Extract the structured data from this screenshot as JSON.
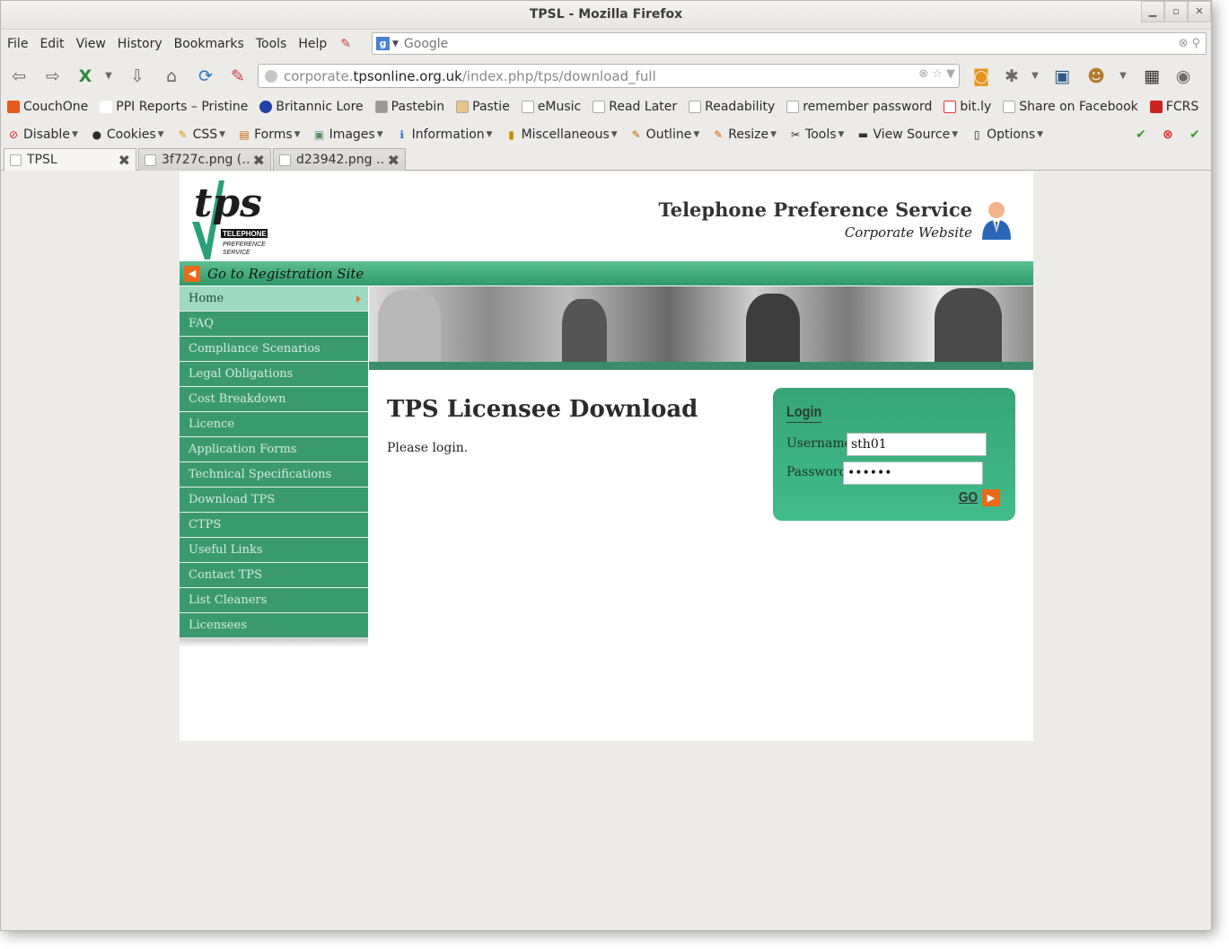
{
  "window": {
    "title": "TPSL - Mozilla Firefox"
  },
  "menu": [
    "File",
    "Edit",
    "View",
    "History",
    "Bookmarks",
    "Tools",
    "Help"
  ],
  "search": {
    "placeholder": "Google",
    "engine_letter": "g"
  },
  "url": {
    "prefix": "corporate.",
    "domain": "tpsonline.org.uk",
    "path": "/index.php/tps/download_full"
  },
  "bookmarks": [
    "CouchOne",
    "PPI Reports – Pristine",
    "Britannic Lore",
    "Pastebin",
    "Pastie",
    "eMusic",
    "Read Later",
    "Readability",
    "remember password",
    "bit.ly",
    "Share on Facebook",
    "FCRS"
  ],
  "devtools": [
    "Disable",
    "Cookies",
    "CSS",
    "Forms",
    "Images",
    "Information",
    "Miscellaneous",
    "Outline",
    "Resize",
    "Tools",
    "View Source",
    "Options"
  ],
  "tabs": [
    "TPSL",
    "3f727c.png (…",
    "d23942.png …"
  ],
  "site": {
    "header_title": "Telephone Preference Service",
    "header_subtitle": "Corporate Website",
    "logo_text": "tps",
    "logo_line1": "TELEPHONE",
    "logo_line2": "PREFERENCE",
    "logo_line3": "SERVICE",
    "registration_link": "Go to Registration Site",
    "nav": [
      "Home",
      "FAQ",
      "Compliance Scenarios",
      "Legal Obligations",
      "Cost Breakdown",
      "Licence",
      "Application Forms",
      "Technical Specifications",
      "Download TPS",
      "CTPS",
      "Useful Links",
      "Contact TPS",
      "List Cleaners",
      "Licensees"
    ],
    "nav_active": "Home",
    "page_title": "TPS Licensee Download",
    "message": "Please login.",
    "login": {
      "heading": "Login",
      "username_label": "Username",
      "username_value": "sth01",
      "password_label": "Password",
      "password_value": "••••••",
      "go": "GO"
    }
  },
  "colors": {
    "nav_green": "#3a9a6f",
    "nav_active": "#9ed9c2",
    "login_green": "#3aae7f",
    "accent_orange": "#e86a1b"
  }
}
